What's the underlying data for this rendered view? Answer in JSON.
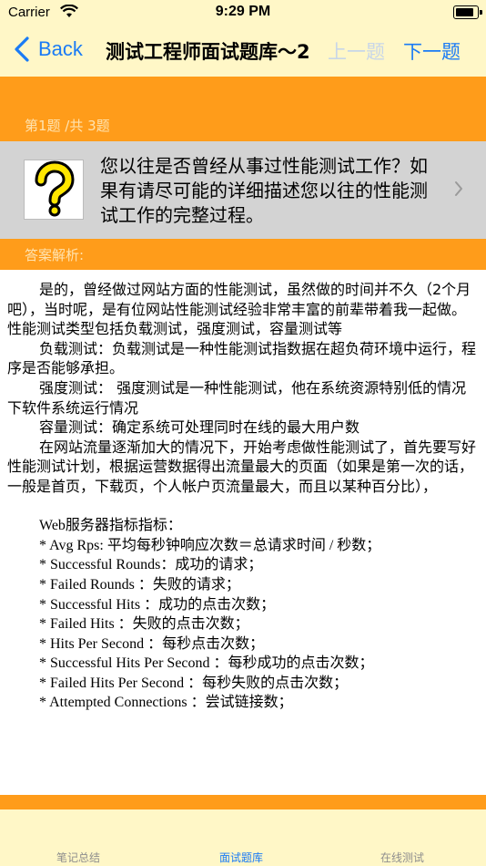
{
  "status_bar": {
    "carrier": "Carrier",
    "time": "9:29 PM"
  },
  "nav": {
    "back_label": "Back",
    "title": "测试工程师面试题库～2",
    "prev_label": "上一题",
    "next_label": "下一题"
  },
  "question": {
    "counter": "第1题 /共 3题",
    "icon": "question-mark-icon",
    "text": "您以往是否曾经从事过性能测试工作？如果有请尽可能的详细描述您以往的性能测试工作的完整过程。"
  },
  "answer": {
    "header": "答案解析:",
    "paragraphs": [
      "是的，曾经做过网站方面的性能测试，虽然做的时间并不久（2个月吧），当时呢，是有位网站性能测试经验非常丰富的前辈带着我一起做。",
      "性能测试类型包括负载测试，强度测试，容量测试等",
      "负载测试：负载测试是一种性能测试指数据在超负荷环境中运行，程序是否能够承担。",
      "强度测试：  强度测试是一种性能测试，他在系统资源特别低的情况下软件系统运行情况",
      "容量测试：确定系统可处理同时在线的最大用户数",
      "在网站流量逐渐加大的情况下，开始考虑做性能测试了，首先要写好性能测试计划，根据运营数据得出流量最大的页面（如果是第一次的话，一般是首页，下载页，个人帐户页流量最大，而且以某种百分比），"
    ],
    "metrics_title": "Web服务器指标指标：",
    "metrics": [
      "* Avg Rps: 平均每秒钟响应次数＝总请求时间 / 秒数；",
      "* Successful Rounds：成功的请求；",
      "* Failed Rounds ：失败的请求；",
      "* Successful Hits ：成功的点击次数；",
      "* Failed Hits ：失败的点击次数；",
      "* Hits Per Second ：每秒点击次数；",
      "* Successful Hits Per Second ：每秒成功的点击次数；",
      "* Failed Hits Per Second ：每秒失败的点击次数；",
      "* Attempted Connections ：尝试链接数；"
    ]
  },
  "tabs": [
    {
      "label": "笔记总结",
      "active": false
    },
    {
      "label": "面试题库",
      "active": true
    },
    {
      "label": "在线测试",
      "active": false
    }
  ],
  "colors": {
    "accent_blue": "#1a7bf5",
    "orange": "#ff9c1a",
    "cream": "#fff7c7",
    "card_gray": "#d3d3d3"
  }
}
